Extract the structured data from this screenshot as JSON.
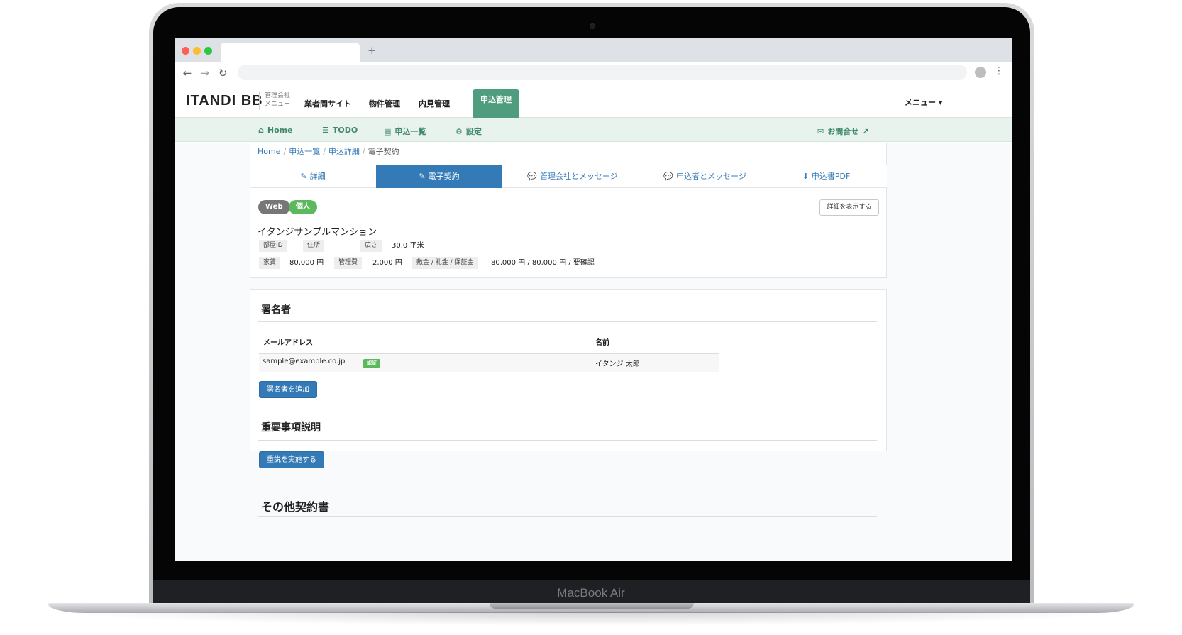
{
  "device": {
    "model_label": "MacBook Air"
  },
  "browser": {
    "new_tab_glyph": "+",
    "back_glyph": "←",
    "forward_glyph": "→",
    "reload_glyph": "↻",
    "menu_glyph": "⋮"
  },
  "header": {
    "logo": "ITANDI BB",
    "logo_sub": [
      "管理会社",
      "メニュー"
    ],
    "nav": [
      "業者間サイト",
      "物件管理",
      "内見管理"
    ],
    "active_nav": "申込管理",
    "user_menu": "メニュー ▾",
    "accent_color": "#4f9d7e"
  },
  "subnav": {
    "home": "Home",
    "todo": "TODO",
    "applications": "申込一覧",
    "settings": "設定",
    "contact": "お問合せ"
  },
  "breadcrumb": [
    "Home",
    "申込一覧",
    "申込詳細",
    "電子契約"
  ],
  "tabs": {
    "detail": "詳細",
    "econtract": "電子契約",
    "mgmt_message": "管理会社とメッセージ",
    "applicant_message": "申込者とメッセージ",
    "pdf": "申込書PDF"
  },
  "badges": {
    "web": "Web",
    "individual": "個人"
  },
  "show_detail_button": "詳細を表示する",
  "property": {
    "name": "イタンジサンプルマンション",
    "room_id_label": "部屋ID",
    "address_label": "住所",
    "area_label": "広さ",
    "area_value": "30.0 平米",
    "rent_label": "家賃",
    "rent_value": "80,000 円",
    "fee_label": "管理費",
    "fee_value": "2,000 円",
    "deposit_label": "敷金 / 礼金 / 保証金",
    "deposit_value": "80,000 円 / 80,000 円 / 要確認"
  },
  "signers": {
    "title": "署名者",
    "col_email": "メールアドレス",
    "col_name": "名前",
    "rows": [
      {
        "email": "sample@example.co.jp",
        "tag": "認証",
        "name": "イタンジ  太郎"
      }
    ],
    "add_button": "署名者を追加"
  },
  "important": {
    "title": "重要事項説明",
    "button": "重説を実施する"
  },
  "other": {
    "title": "その他契約書"
  }
}
